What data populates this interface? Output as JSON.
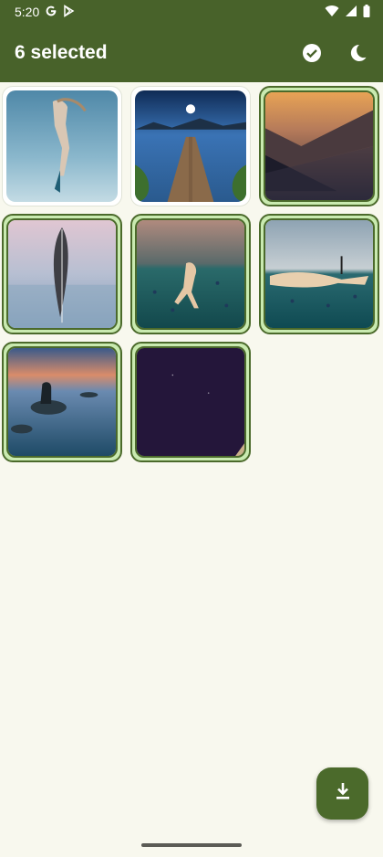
{
  "status_bar": {
    "time": "5:20",
    "icons": [
      "google-g-icon",
      "play-store-icon",
      "wifi-icon",
      "signal-icon",
      "battery-icon"
    ]
  },
  "app_bar": {
    "title": "6 selected",
    "actions": [
      "select-all-icon",
      "theme-toggle-icon"
    ]
  },
  "gallery": {
    "items": [
      {
        "subject": "underwater-diver",
        "selected": false
      },
      {
        "subject": "lake-pier-moon",
        "selected": false
      },
      {
        "subject": "mountain-sunset",
        "selected": true
      },
      {
        "subject": "feather",
        "selected": true
      },
      {
        "subject": "swimmer-underwater",
        "selected": true
      },
      {
        "subject": "snorkeler-underwater",
        "selected": true
      },
      {
        "subject": "person-on-rock-lake",
        "selected": true
      },
      {
        "subject": "dark-night-sky",
        "selected": true
      }
    ]
  },
  "fab": {
    "icon": "download-icon"
  },
  "colors": {
    "primary": "#48622a",
    "background": "#f8f8ee",
    "selected_container": "#c9eab0"
  }
}
